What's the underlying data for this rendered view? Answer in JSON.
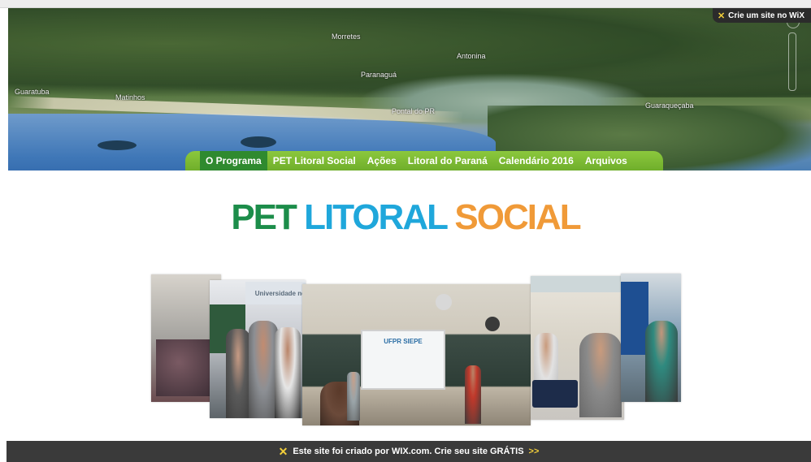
{
  "badge": {
    "icon": "wix-x-icon",
    "label": "Crie um site no WiX"
  },
  "map_labels": [
    {
      "text": "Morretes"
    },
    {
      "text": "Antonina"
    },
    {
      "text": "Paranaguá"
    },
    {
      "text": "Guaratuba"
    },
    {
      "text": "Matinhos"
    },
    {
      "text": "Pontal do PR"
    },
    {
      "text": "Guaraqueçaba"
    }
  ],
  "nav": {
    "items": [
      {
        "label": "O Programa",
        "active": true
      },
      {
        "label": "PET Litoral Social",
        "active": false
      },
      {
        "label": "Ações",
        "active": false
      },
      {
        "label": "Litoral do Paraná",
        "active": false
      },
      {
        "label": "Calendário 2016",
        "active": false
      },
      {
        "label": "Arquivos",
        "active": false
      }
    ],
    "color": "#7bb934",
    "active_color": "#2f8a2f"
  },
  "logo": {
    "word1": "PET",
    "word2": "LITORAL",
    "word3": "SOCIAL",
    "colors": [
      "#1c8d4a",
      "#1fa7db",
      "#f09a38"
    ]
  },
  "slide_text": {
    "banner": "Universidade no",
    "screen": "UFPR SIEPE"
  },
  "footer": {
    "icon": "wix-x-icon",
    "text": "Este site foi criado por WIX.com. Crie seu site GRÁTIS",
    "arrows": ">>"
  }
}
